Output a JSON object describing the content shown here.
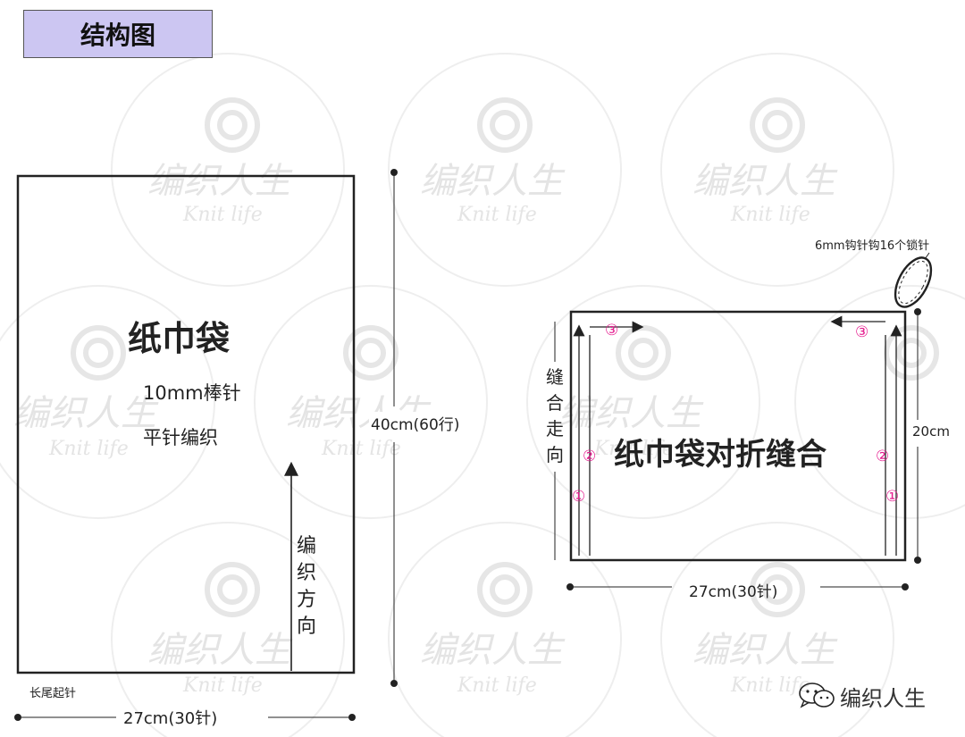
{
  "header": {
    "title": "结构图"
  },
  "watermark": {
    "text": "编织人生",
    "subtext": "Knit life"
  },
  "left_panel": {
    "piece_name": "纸巾袋",
    "needle": "10mm棒针",
    "stitch": "平针编织",
    "direction_label": "编织方向",
    "height_label": "40cm(60行)",
    "width_label": "27cm(30针)",
    "cast_on_label": "长尾起针"
  },
  "right_panel": {
    "title": "纸巾袋对折缝合",
    "seam_direction": "缝合走向",
    "loop_note": "6mm钩针钩16个锁针",
    "height_label": "20cm",
    "width_label": "27cm(30针)",
    "markers": [
      "①",
      "②",
      "③"
    ]
  },
  "footer": {
    "brand": "编织人生"
  },
  "colors": {
    "title_bg": "#ccc6f2",
    "marker": "#e51c8f",
    "line": "#222222",
    "watermark": "#e4e4e4"
  }
}
